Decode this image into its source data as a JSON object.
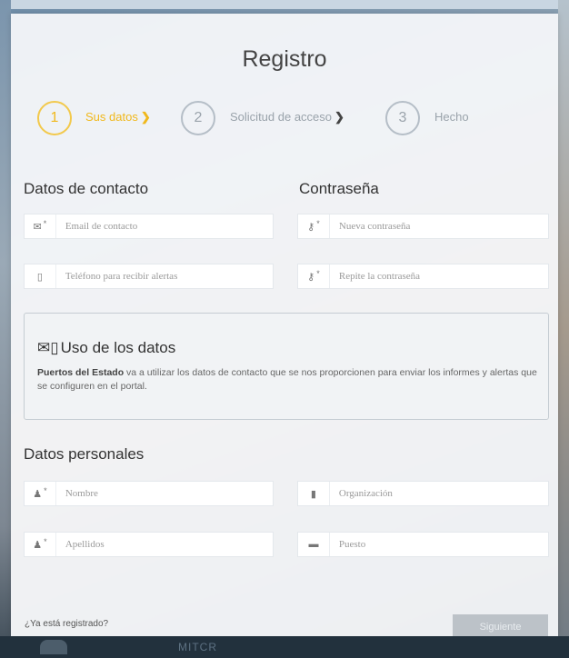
{
  "title": "Registro",
  "steps": [
    {
      "number": "1",
      "label": "Sus datos",
      "chevron": "❯"
    },
    {
      "number": "2",
      "label": "Solicitud de acceso",
      "chevron": "❯"
    },
    {
      "number": "3",
      "label": "Hecho"
    }
  ],
  "contact": {
    "heading": "Datos de contacto",
    "email": {
      "icon": "envelope-icon",
      "glyph": "✉",
      "required": "*",
      "placeholder": "Email de contacto"
    },
    "phone": {
      "icon": "mobile-icon",
      "glyph": "▯",
      "placeholder": "Teléfono para recibir alertas"
    }
  },
  "password": {
    "heading": "Contraseña",
    "new": {
      "icon": "key-icon",
      "glyph": "⚷",
      "required": "*",
      "placeholder": "Nueva contraseña"
    },
    "repeat": {
      "icon": "key-icon",
      "glyph": "⚷",
      "required": "*",
      "placeholder": "Repite la contraseña"
    }
  },
  "data_usage": {
    "title": "Uso de los datos",
    "icons": [
      "envelope-icon",
      "mobile-icon"
    ],
    "icon_glyphs": "✉▯",
    "org": "Puertos del Estado",
    "text": " va a utilizar los datos de contacto que se nos proporcionen para enviar los informes y alertas que se configuren en el portal."
  },
  "personal": {
    "heading": "Datos personales",
    "name": {
      "icon": "user-icon",
      "glyph": "♟",
      "required": "*",
      "placeholder": "Nombre"
    },
    "surname": {
      "icon": "user-icon",
      "glyph": "♟",
      "required": "*",
      "placeholder": "Apellidos"
    },
    "organization": {
      "icon": "building-icon",
      "glyph": "▮",
      "placeholder": "Organización"
    },
    "position": {
      "icon": "briefcase-icon",
      "glyph": "▬",
      "placeholder": "Puesto"
    }
  },
  "footer": {
    "registered_link": "¿Ya está registrado?",
    "next_button": "Siguiente",
    "bottom_text": "MITCR"
  },
  "colors": {
    "accent": "#f0b81c",
    "panel": "#f7f9fb",
    "button_disabled": "#bcc2c8"
  }
}
